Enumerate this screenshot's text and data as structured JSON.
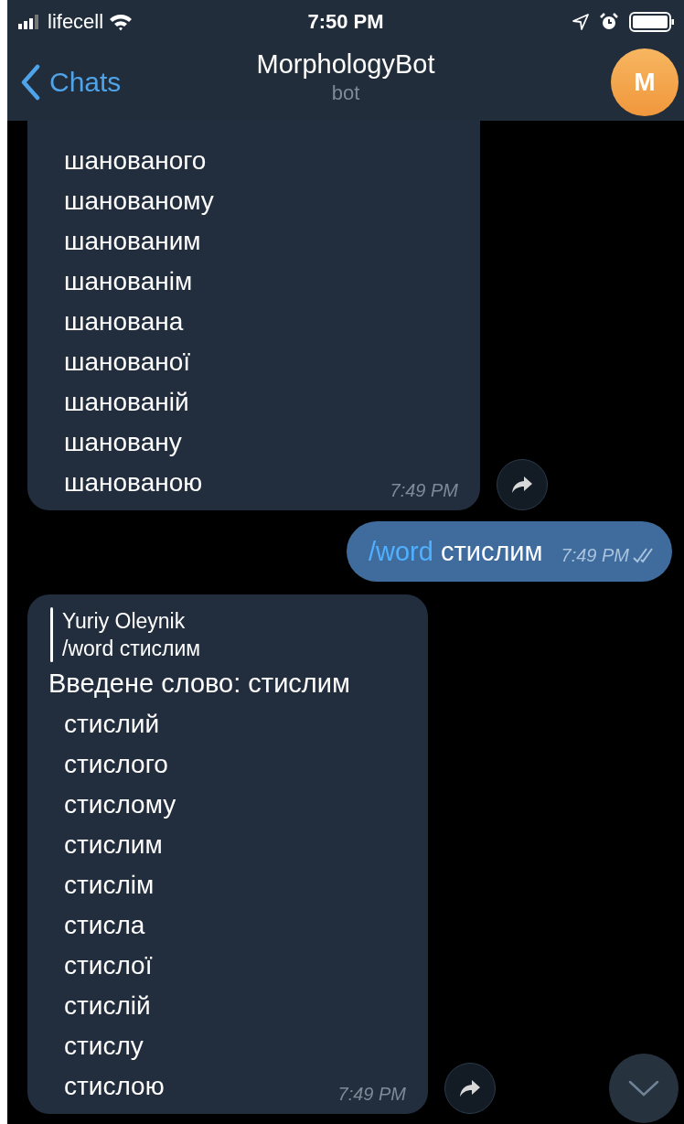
{
  "status_bar": {
    "carrier": "lifecell",
    "time": "7:50 PM"
  },
  "header": {
    "back_label": "Chats",
    "title": "MorphologyBot",
    "subtitle": "bot",
    "avatar_letter": "M"
  },
  "messages": [
    {
      "kind": "incoming",
      "lines": [
        "шанованого",
        "шанованому",
        "шанованим",
        "шанованім",
        "шанована",
        "шанованої",
        "шанованій",
        "шановану",
        "шанованою"
      ],
      "time": "7:49 PM",
      "forward": true
    },
    {
      "kind": "outgoing",
      "command": "/word",
      "text": "стислим",
      "time": "7:49 PM",
      "read": true
    },
    {
      "kind": "incoming",
      "reply": {
        "author": "Yuriy Oleynik",
        "text": "/word стислим"
      },
      "intro": "Введене слово: стислим",
      "lines": [
        "стислий",
        "стислого",
        "стислому",
        "стислим",
        "стислім",
        "стисла",
        "стислої",
        "стислій",
        "стислу",
        "стислою"
      ],
      "time": "7:49 PM",
      "forward": true
    }
  ]
}
